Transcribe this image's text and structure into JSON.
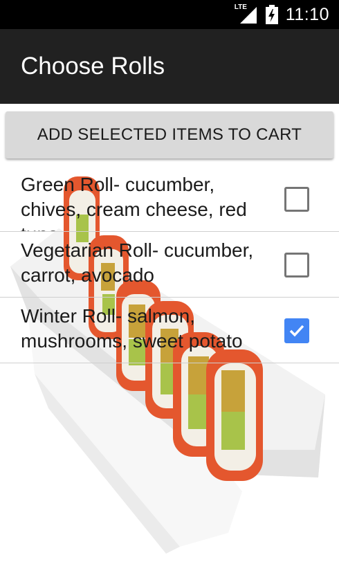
{
  "status_bar": {
    "time": "11:10",
    "network_label": "LTE",
    "icons": [
      "lte-signal-icon",
      "battery-charging-icon"
    ]
  },
  "app_bar": {
    "title": "Choose Rolls"
  },
  "actions": {
    "add_selected_label": "ADD SELECTED ITEMS TO CART"
  },
  "rolls": [
    {
      "label": "Green Roll- cucumber, chives, cream cheese, red tuna",
      "checked": false
    },
    {
      "label": "Vegetarian Roll- cucumber, carrot, avocado",
      "checked": false
    },
    {
      "label": "Winter Roll- salmon, mushrooms, sweet potato",
      "checked": true
    }
  ],
  "background_image": "sushi-rolls-plate",
  "colors": {
    "status_bar": "#000000",
    "app_bar": "#212121",
    "checkbox_accent": "#4285f4",
    "button_bg": "#d9d9d9"
  }
}
